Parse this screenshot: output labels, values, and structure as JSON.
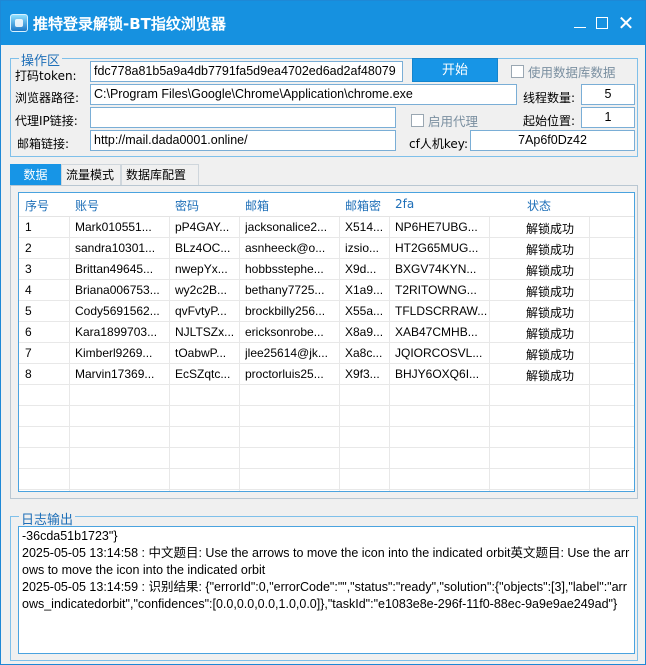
{
  "window": {
    "title": "推特登录解锁-BT指纹浏览器"
  },
  "ops": {
    "legend": "操作区",
    "token_label": "打码token:",
    "token_value": "fdc778a81b5a9a4db7791fa5d9ea4702ed6ad2af48079",
    "start_button": "开始",
    "use_db_label": "使用数据库数据",
    "browser_path_label": "浏览器路径:",
    "browser_path_value": "C:\\Program Files\\Google\\Chrome\\Application\\chrome.exe",
    "thread_count_label": "线程数量:",
    "thread_count_value": "5",
    "proxy_label": "代理IP链接:",
    "proxy_value": "",
    "enable_proxy_label": "启用代理",
    "start_pos_label": "起始位置:",
    "start_pos_value": "1",
    "email_link_label": "邮箱链接:",
    "email_link_value": "http://mail.dada0001.online/",
    "cf_key_label": "cf人机key:",
    "cf_key_value": "7Ap6f0Dz42"
  },
  "tabs": [
    "数据",
    "流量模式",
    "数据库配置"
  ],
  "table": {
    "columns": [
      "序号",
      "账号",
      "密码",
      "邮箱",
      "邮箱密",
      "2fa",
      "状态"
    ],
    "rows": [
      [
        "1",
        "Mark010551...",
        "pP4GAY...",
        "jacksonalice2...",
        "X514...",
        "NP6HE7UBG...",
        "解锁成功"
      ],
      [
        "2",
        "sandra10301...",
        "BLz4OC...",
        "asnheeck@o...",
        "izsio...",
        "HT2G65MUG...",
        "解锁成功"
      ],
      [
        "3",
        "Brittan49645...",
        "nwepYx...",
        "hobbsstephe...",
        "X9d...",
        "BXGV74KYN...",
        "解锁成功"
      ],
      [
        "4",
        "Briana006753...",
        "wy2c2B...",
        "bethany7725...",
        "X1a9...",
        "T2RITOWNG...",
        "解锁成功"
      ],
      [
        "5",
        "Cody5691562...",
        "qvFvtyP...",
        "brockbilly256...",
        "X55a...",
        "TFLDSCRRAW...",
        "解锁成功"
      ],
      [
        "6",
        "Kara1899703...",
        "NJLTSZx...",
        "ericksonrobe...",
        "X8a9...",
        "XAB47CMHB...",
        "解锁成功"
      ],
      [
        "7",
        "Kimberl9269...",
        "tOabwP...",
        "jlee25614@jk...",
        "Xa8c...",
        "JQIORCOSVL...",
        "解锁成功"
      ],
      [
        "8",
        "Marvin17369...",
        "EcSZqtc...",
        "proctorluis25...",
        "X9f3...",
        "BHJY6OXQ6I...",
        "解锁成功"
      ]
    ]
  },
  "log": {
    "legend": "日志输出",
    "lines": [
      "-36cda51b1723\"}",
      "2025-05-05 13:14:58 : 中文题目: Use the arrows to move the icon into the indicated orbit英文题目: Use the arrows to move the icon into the indicated orbit",
      "2025-05-05 13:14:59 : 识别结果: {\"errorId\":0,\"errorCode\":\"\",\"status\":\"ready\",\"solution\":{\"objects\":[3],\"label\":\"arrows_indicatedorbit\",\"confidences\":[0.0,0.0,0.0,1.0,0.0]},\"taskId\":\"e1083e8e-296f-11f0-88ec-9a9e9ae249ad\"}"
    ]
  }
}
